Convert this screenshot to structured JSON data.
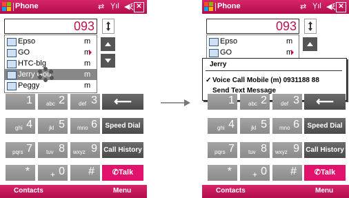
{
  "colors": {
    "accent": "#c0104f",
    "titlebar": "#c8195c",
    "key": "#999999",
    "talk": "#e0126c"
  },
  "left": {
    "title": "Phone",
    "number": "093",
    "contacts": [
      {
        "name": "Epso",
        "type": "m",
        "more": false
      },
      {
        "name": "GO",
        "type": "m",
        "more": true
      },
      {
        "name": "HTC-blg",
        "type": "m",
        "more": false
      },
      {
        "name": "Jerry Gou",
        "type": "m",
        "more": false,
        "selected": true
      },
      {
        "name": "Peggy",
        "type": "m",
        "more": false
      }
    ],
    "softkeys": {
      "left": "Contacts",
      "right": "Menu"
    }
  },
  "right": {
    "title": "Phone",
    "number": "093",
    "contacts": [
      {
        "name": "Epso",
        "type": "m",
        "more": false
      },
      {
        "name": "GO",
        "type": "m",
        "more": true
      }
    ],
    "menu": {
      "header": "Jerry",
      "items": [
        {
          "label": "Voice Call Mobile (m) 0931188 88",
          "checked": true
        },
        {
          "label": "Send Text Message",
          "checked": false
        }
      ]
    },
    "softkeys": {
      "left": "Contacts",
      "right": "Menu"
    }
  },
  "keypad": {
    "keys": [
      {
        "big": "1",
        "small": ""
      },
      {
        "big": "2",
        "small": "abc"
      },
      {
        "big": "3",
        "small": "def"
      },
      {
        "big": "4",
        "small": "ghi"
      },
      {
        "big": "5",
        "small": "jkl"
      },
      {
        "big": "6",
        "small": "mno"
      },
      {
        "big": "7",
        "small": "pqrs"
      },
      {
        "big": "8",
        "small": "tuv"
      },
      {
        "big": "9",
        "small": "wxyz"
      },
      {
        "big": "*",
        "small": ""
      },
      {
        "big": "0",
        "small": "+"
      },
      {
        "big": "#",
        "small": ""
      }
    ],
    "speed_dial": "Speed Dial",
    "call_history": "Call History",
    "talk": "Talk",
    "backspace": "⟵"
  },
  "icons": [
    "windows-flag-icon",
    "connectivity-icon",
    "signal-icon",
    "volume-icon",
    "close-icon",
    "up-down-icon",
    "up-arrow-icon",
    "down-arrow-icon",
    "contact-card-icon",
    "backspace-icon",
    "phone-icon",
    "checkmark-icon",
    "right-arrow-icon"
  ]
}
